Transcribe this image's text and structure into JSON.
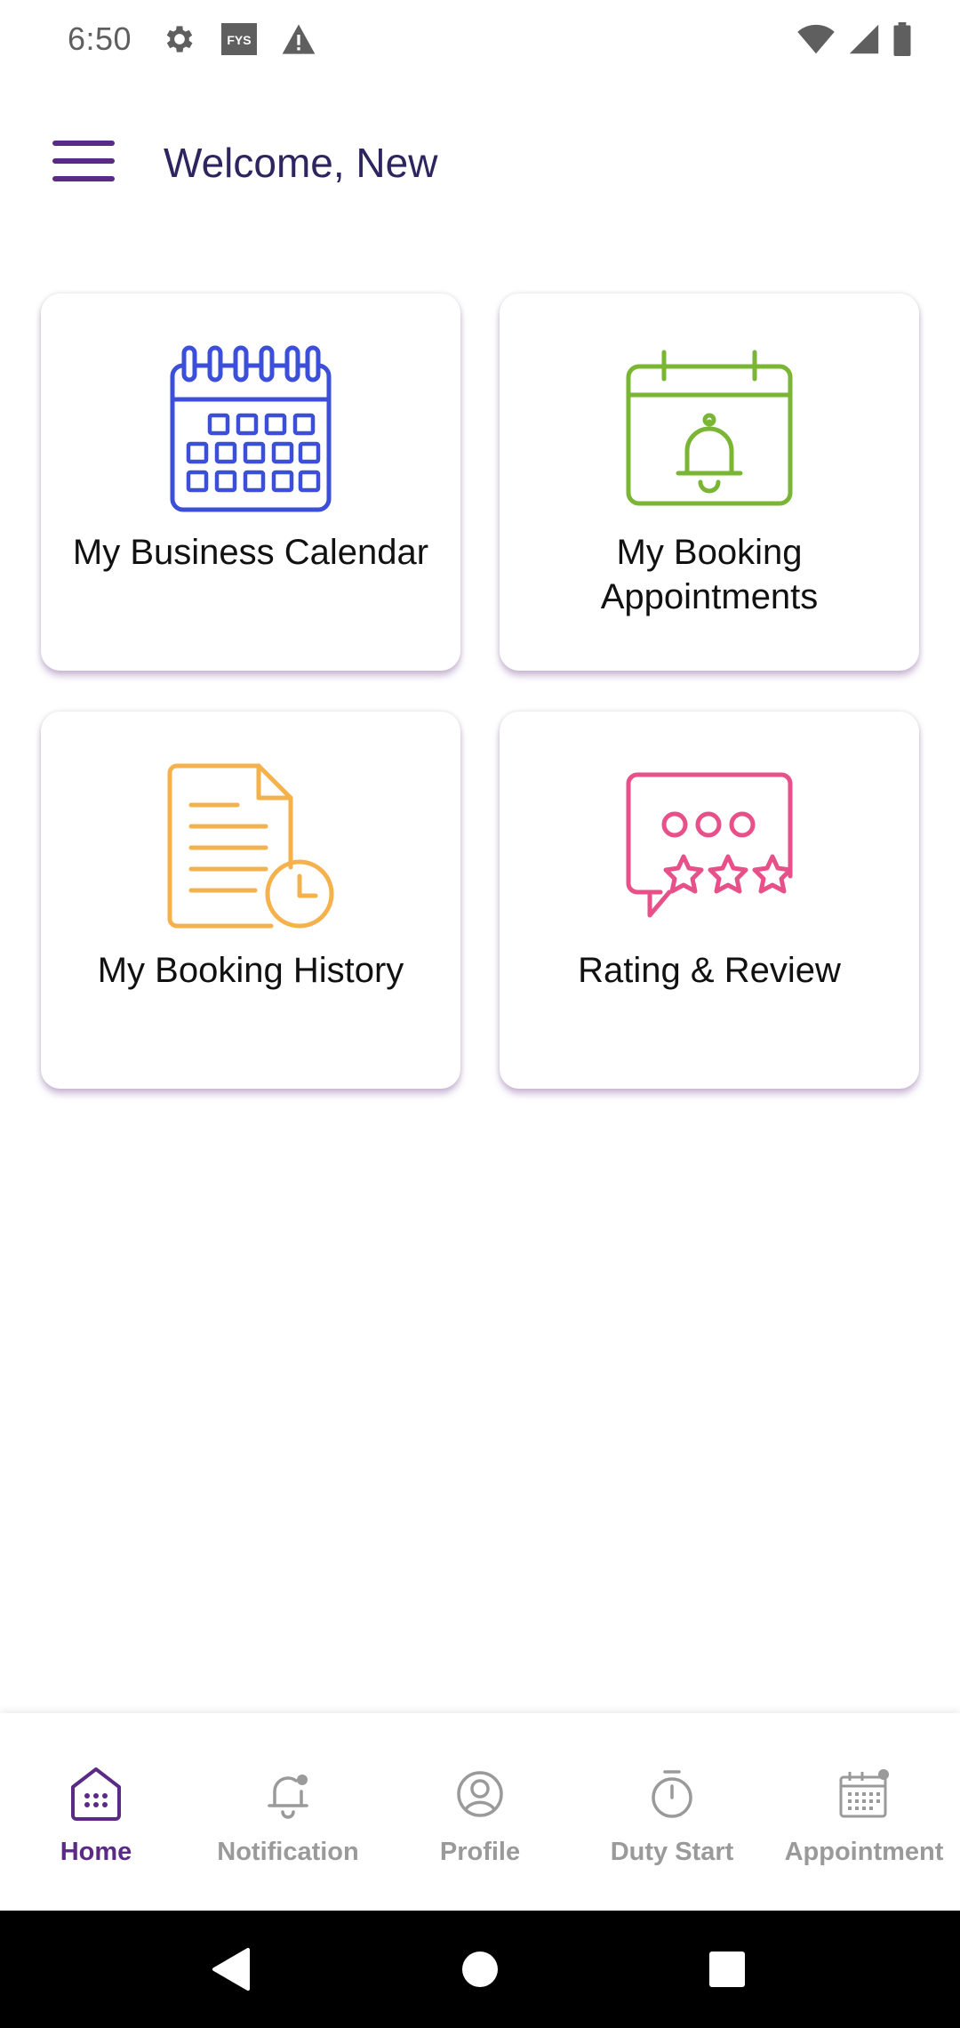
{
  "status_bar": {
    "time": "6:50",
    "icons_left": [
      "gear-icon",
      "fys-app-icon",
      "warning-icon"
    ],
    "fys_badge": "FYS",
    "icons_right": [
      "wifi-icon",
      "cellular-signal-icon",
      "battery-icon"
    ]
  },
  "app_bar": {
    "menu_icon": "hamburger-menu-icon",
    "title": "Welcome, New"
  },
  "cards": [
    {
      "label": "My Business Calendar",
      "icon": "calendar-grid-icon",
      "color": "#3b4fd8"
    },
    {
      "label": "My Booking Appointments",
      "icon": "calendar-bell-icon",
      "color": "#7ab534"
    },
    {
      "label": "My Booking History",
      "icon": "document-clock-icon",
      "color": "#f5b14c"
    },
    {
      "label": "Rating & Review",
      "icon": "chat-stars-icon",
      "color": "#e8508a"
    }
  ],
  "bottom_nav": {
    "items": [
      {
        "label": "Home",
        "icon": "home-grid-icon",
        "active": true
      },
      {
        "label": "Notification",
        "icon": "bell-icon",
        "active": false
      },
      {
        "label": "Profile",
        "icon": "user-circle-icon",
        "active": false
      },
      {
        "label": "Duty Start",
        "icon": "stopwatch-icon",
        "active": false
      },
      {
        "label": "Appointment",
        "icon": "calendar-icon",
        "active": false
      }
    ],
    "active_color": "#5b2a86",
    "inactive_color": "#9a9a9a"
  },
  "system_nav": {
    "buttons": [
      "back-icon",
      "home-circle-icon",
      "recents-square-icon"
    ]
  },
  "colors": {
    "title": "#2e2460",
    "menu": "#5b2a86"
  }
}
